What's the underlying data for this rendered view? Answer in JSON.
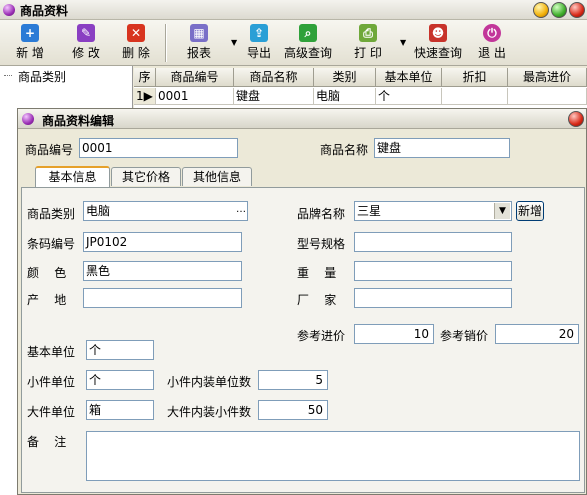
{
  "window": {
    "title": "商品资料"
  },
  "toolbar": {
    "new": "新 增",
    "edit": "修 改",
    "delete": "删 除",
    "report": "报表",
    "export": "导出",
    "advanced_query": "高级查询",
    "print": "打 印",
    "quick_query": "快速查询",
    "exit": "退 出"
  },
  "category_panel": {
    "root": "商品类别"
  },
  "grid": {
    "columns": [
      "序号",
      "商品编号",
      "商品名称",
      "类别",
      "基本单位",
      "折扣",
      "最高进价"
    ],
    "row": {
      "index": "1",
      "code": "0001",
      "name": "键盘",
      "category": "电脑",
      "unit": "个",
      "discount": "",
      "max_price": ""
    }
  },
  "dialog": {
    "title": "商品资料编辑",
    "code_label": "商品编号",
    "code_value": "0001",
    "name_label": "商品名称",
    "name_value": "键盘",
    "tabs": [
      "基本信息",
      "其它价格",
      "其他信息"
    ],
    "category_label": "商品类别",
    "category_value": "电脑",
    "brand_label": "品牌名称",
    "brand_value": "三星",
    "brand_new": "新增",
    "barcode_label": "条码编号",
    "barcode_value": "JP0102",
    "model_label": "型号规格",
    "model_value": "",
    "color_label": "颜    色",
    "color_value": "黑色",
    "weight_label": "重    量",
    "weight_value": "",
    "origin_label": "产    地",
    "origin_value": "",
    "maker_label": "厂    家",
    "maker_value": "",
    "ref_cost_label": "参考进价",
    "ref_cost_value": "10",
    "ref_sale_label": "参考销价",
    "ref_sale_value": "20",
    "base_unit_label": "基本单位",
    "base_unit_value": "个",
    "small_unit_label": "小件单位",
    "small_unit_value": "个",
    "small_qty_label": "小件内装单位数",
    "small_qty_value": "5",
    "large_unit_label": "大件单位",
    "large_unit_value": "箱",
    "large_qty_label": "大件内装小件数",
    "large_qty_value": "50",
    "note_label": "备    注",
    "note_value": ""
  },
  "colors": {
    "accent": "#e6a12a",
    "field_border": "#7f9db9"
  }
}
